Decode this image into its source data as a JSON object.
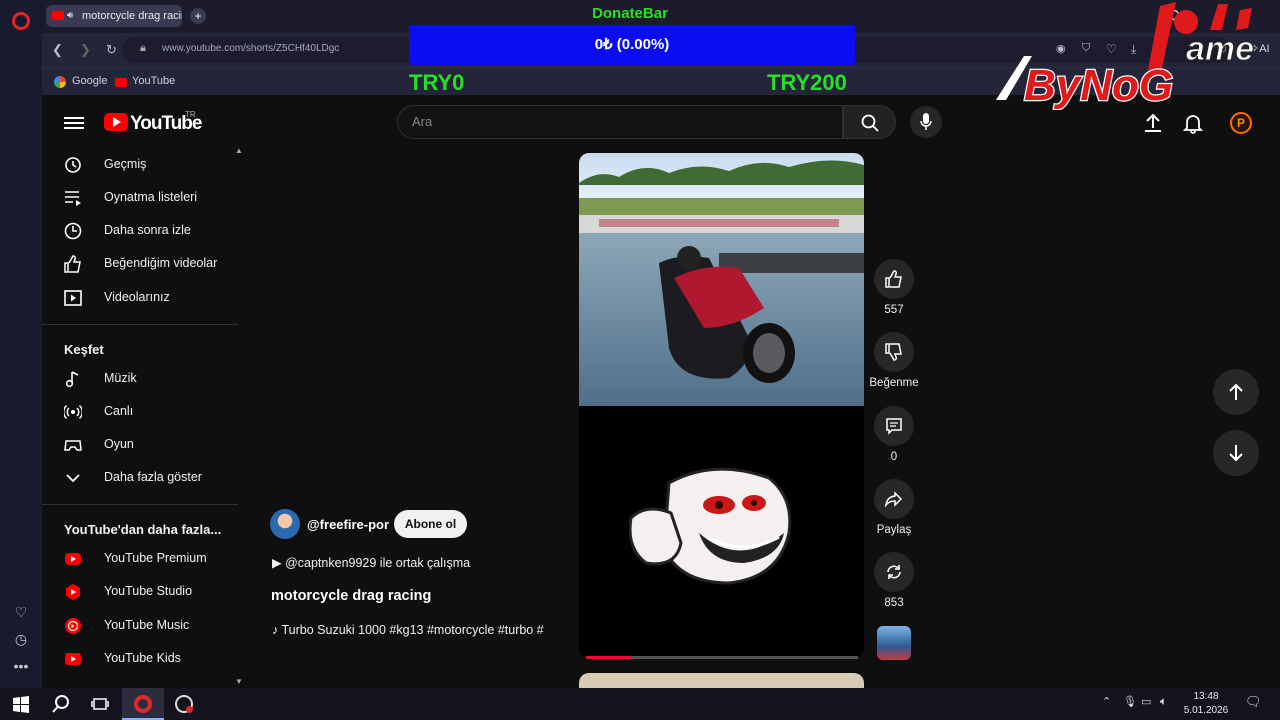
{
  "browser": {
    "tab_title": "motorcycle drag racin",
    "url": "www.youtube.com/shorts/Z5CHf40LDgc",
    "bookmarks": [
      "Google",
      "YouTube"
    ],
    "ai_label": "AI"
  },
  "donate": {
    "title": "DonateBar",
    "amount_text": "0₺ (0.00%)",
    "progress_fraction": 0.0,
    "min_label": "TRY0",
    "max_label": "TRY200"
  },
  "overlay_logo": {
    "text": "ByNoG",
    "sub_text": "ame"
  },
  "youtube": {
    "logo_text": "YouTube",
    "region": "TR",
    "search_placeholder": "Ara",
    "avatar_letter": "P"
  },
  "sidebar": {
    "items": [
      {
        "label": "Geçmiş",
        "icon": "history-icon"
      },
      {
        "label": "Oynatma listeleri",
        "icon": "playlist-icon"
      },
      {
        "label": "Daha sonra izle",
        "icon": "watch-later-icon"
      },
      {
        "label": "Beğendiğim videolar",
        "icon": "like-icon"
      },
      {
        "label": "Videolarınız",
        "icon": "your-videos-icon"
      }
    ],
    "explore_title": "Keşfet",
    "explore": [
      {
        "label": "Müzik",
        "icon": "music-icon"
      },
      {
        "label": "Canlı",
        "icon": "live-icon"
      },
      {
        "label": "Oyun",
        "icon": "gaming-icon"
      },
      {
        "label": "Daha fazla göster",
        "icon": "chevron-down-icon"
      }
    ],
    "more_title": "YouTube'dan daha fazla...",
    "more": [
      {
        "label": "YouTube Premium",
        "icon": "youtube-premium-icon"
      },
      {
        "label": "YouTube Studio",
        "icon": "youtube-studio-icon"
      },
      {
        "label": "YouTube Music",
        "icon": "youtube-music-icon"
      },
      {
        "label": "YouTube Kids",
        "icon": "youtube-kids-icon"
      }
    ]
  },
  "short": {
    "channel": "@freefire-por",
    "subscribe_label": "Abone ol",
    "collab": "@captnken9929 ile ortak çalışma",
    "title": "motorcycle drag racing",
    "description": "Turbo Suzuki 1000 #kg13 #motorcycle #turbo #",
    "progress_fraction": 0.17,
    "likes": "557",
    "dislike_label": "Beğenme",
    "comments": "0",
    "share_label": "Paylaş",
    "remix_count": "853"
  },
  "taskbar": {
    "time": "13:48",
    "date": "5.01.2026"
  },
  "colors": {
    "yt_red": "#ff0000",
    "donate_green": "#25e028",
    "donate_blue": "#0b0cf0",
    "opera_red": "#e0262a"
  }
}
